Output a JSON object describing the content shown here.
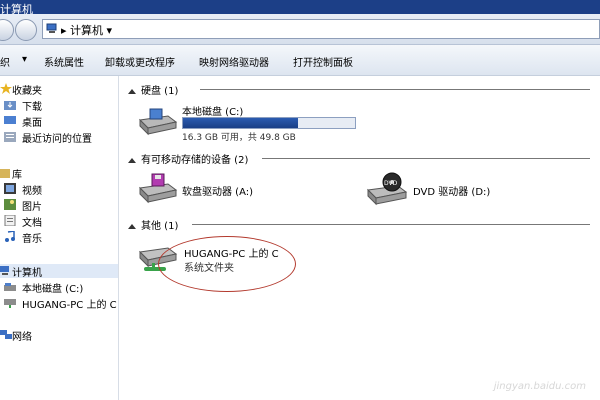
{
  "titlebar": {
    "title": "计算机"
  },
  "address": {
    "crumb": "计算机",
    "crumb_chevron": "▸",
    "dropdown": "▾"
  },
  "commands": [
    {
      "label": "织"
    },
    {
      "label": "系统属性"
    },
    {
      "label": "卸载或更改程序"
    },
    {
      "label": "映射网络驱动器"
    },
    {
      "label": "打开控制面板"
    }
  ],
  "sidebar": {
    "favorites": {
      "label": "收藏夹",
      "items": [
        {
          "label": "下载"
        },
        {
          "label": "桌面"
        },
        {
          "label": "最近访问的位置"
        }
      ]
    },
    "libraries": {
      "label": "库",
      "items": [
        {
          "label": "视频"
        },
        {
          "label": "图片"
        },
        {
          "label": "文档"
        },
        {
          "label": "音乐"
        }
      ]
    },
    "computer": {
      "label": "计算机",
      "items": [
        {
          "label": "本地磁盘 (C:)"
        },
        {
          "label": "HUGANG-PC 上的 C"
        }
      ]
    },
    "network": {
      "label": "网络"
    }
  },
  "main": {
    "hard_disks": {
      "header": "硬盘 (1)",
      "drive_name": "本地磁盘 (C:)",
      "drive_info": "16.3 GB 可用，共 49.8 GB",
      "used_fraction": 0.67
    },
    "removable": {
      "header": "有可移动存储的设备 (2)",
      "floppy": "软盘驱动器 (A:)",
      "dvd": "DVD 驱动器 (D:)",
      "dvd_badge": "DVD"
    },
    "other": {
      "header": "其他 (1)",
      "item_line1": "HUGANG-PC 上的 C",
      "item_line2": "系统文件夹"
    }
  },
  "watermark": "jingyan.baidu.com",
  "colors": {
    "titlebar": "#1c3f87",
    "progress_fill": "#1a3f86",
    "annotation_ellipse": "#b33a2e"
  }
}
